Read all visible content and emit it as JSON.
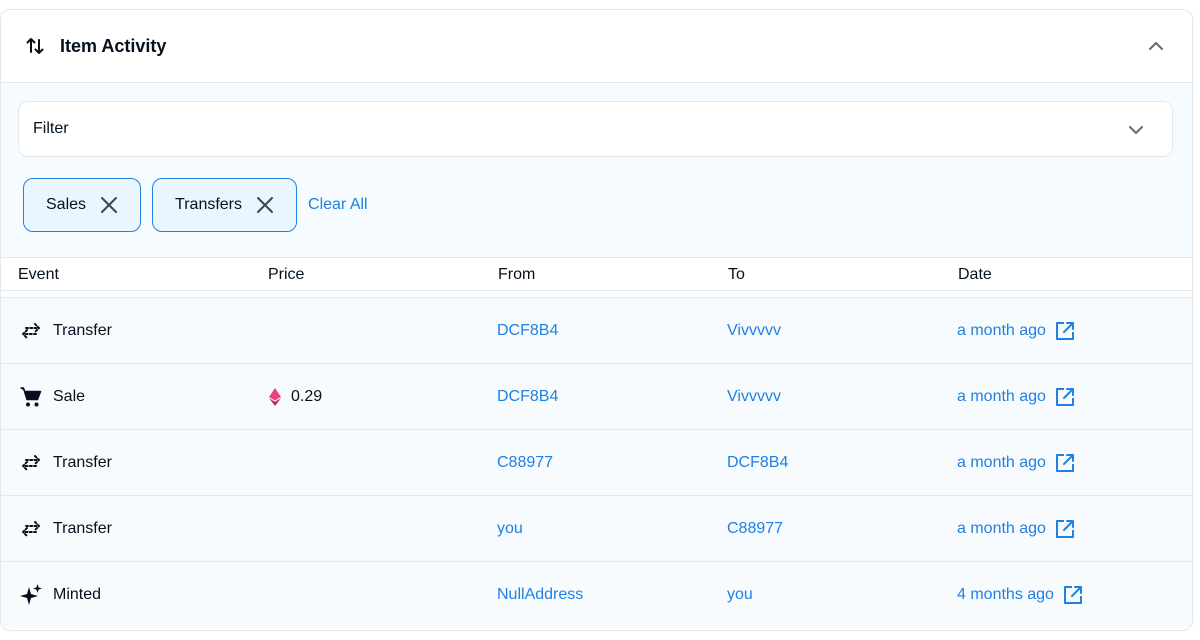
{
  "header": {
    "title": "Item Activity"
  },
  "filter": {
    "label": "Filter"
  },
  "chips": [
    {
      "label": "Sales"
    },
    {
      "label": "Transfers"
    }
  ],
  "clear_all": "Clear All",
  "columns": [
    "Event",
    "Price",
    "From",
    "To",
    "Date"
  ],
  "rows": [
    {
      "event": "Transfer",
      "icon": "transfer-icon",
      "price": "",
      "from": "DCF8B4",
      "to": "Vivvvvv",
      "date": "a month ago"
    },
    {
      "event": "Sale",
      "icon": "cart-icon",
      "price": "0.29",
      "from": "DCF8B4",
      "to": "Vivvvvv",
      "date": "a month ago"
    },
    {
      "event": "Transfer",
      "icon": "transfer-icon",
      "price": "",
      "from": "C88977",
      "to": "DCF8B4",
      "date": "a month ago"
    },
    {
      "event": "Transfer",
      "icon": "transfer-icon",
      "price": "",
      "from": "you",
      "to": "C88977",
      "date": "a month ago"
    },
    {
      "event": "Minted",
      "icon": "sparkle-icon",
      "price": "",
      "from": "NullAddress",
      "to": "you",
      "date": "4 months ago"
    }
  ],
  "colors": {
    "accent": "#2081e2",
    "text": "#04111d",
    "border": "#e5e8eb",
    "eth": "#e6457a"
  }
}
